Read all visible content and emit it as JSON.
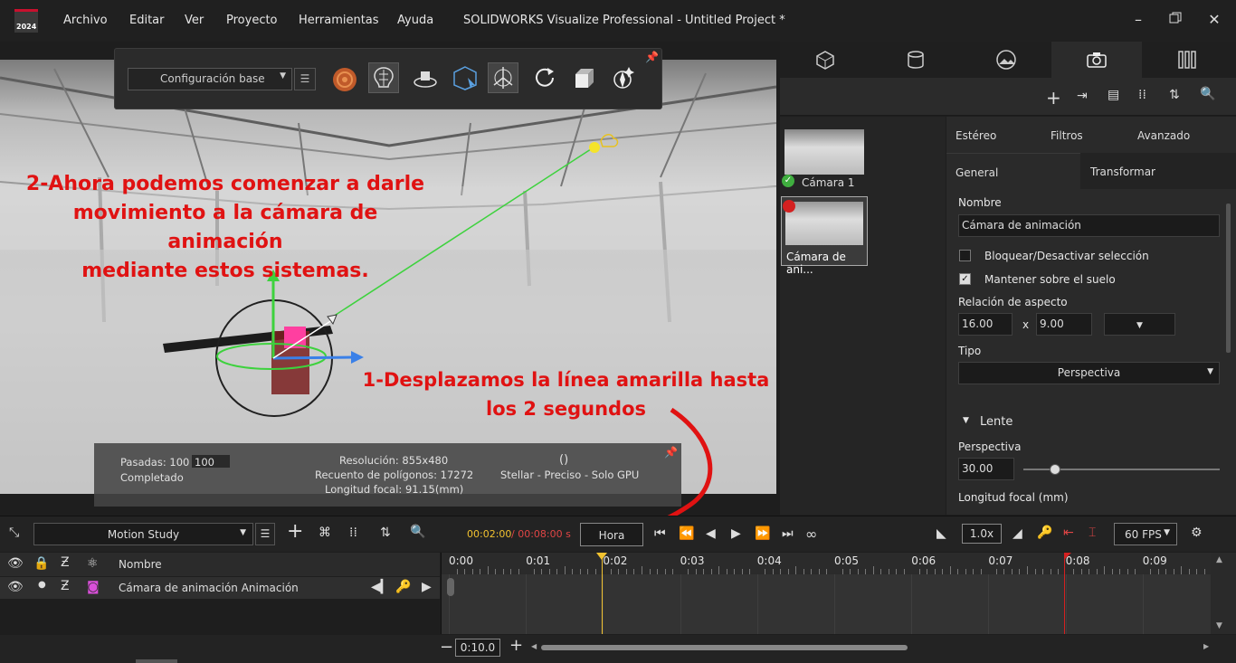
{
  "app": {
    "title": "SOLIDWORKS Visualize Professional - Untitled Project *",
    "logo_year": "2024"
  },
  "menu": [
    "Archivo",
    "Editar",
    "Ver",
    "Proyecto",
    "Herramientas",
    "Ayuda"
  ],
  "toolbar": {
    "config_select": "Configuración base"
  },
  "annotations": {
    "a2": [
      "2-Ahora podemos comenzar a darle",
      "movimiento a la cámara de animación",
      "mediante estos sistemas."
    ],
    "a1": [
      "1-Desplazamos la línea amarilla hasta",
      "los 2 segundos"
    ]
  },
  "stats": {
    "passes_label": "Pasadas: 100 /",
    "passes_value": "100",
    "completed": "Completado",
    "resolution": "Resolución: 855x480",
    "polygons": "Recuento de polígonos: 17272",
    "focal": "Longitud focal: 91.15(mm)",
    "mode": "Stellar - Preciso - Solo GPU"
  },
  "cameras": [
    {
      "label": "Cámara 1"
    },
    {
      "label": "Cámara de ani..."
    }
  ],
  "props": {
    "tabs_top": [
      "Estéreo",
      "Filtros",
      "Avanzado"
    ],
    "tabs_sub": [
      "General",
      "Transformar"
    ],
    "name_label": "Nombre",
    "name_value": "Cámara de animación",
    "lock_label": "Bloquear/Desactivar selección",
    "ground_label": "Mantener sobre el suelo",
    "aspect_label": "Relación de aspecto",
    "aspect_w": "16.00",
    "aspect_x": "x",
    "aspect_h": "9.00",
    "type_label": "Tipo",
    "type_value": "Perspectiva",
    "lens_label": "Lente",
    "persp_label": "Perspectiva",
    "persp_value": "30.00",
    "persp_slider": 0.06,
    "focal_label": "Longitud focal (mm)"
  },
  "bottom": {
    "study": "Motion Study",
    "time_current": "00:02:00",
    "time_total": "/ 00:08:00 s",
    "hora": "Hora",
    "speed": "1.0x",
    "fps": "60 FPS",
    "zoom": "0:10.0"
  },
  "timeline": {
    "header_name": "Nombre",
    "row_name": "Cámara de animación Animación",
    "ticks": [
      "0:00",
      "0:01",
      "0:02",
      "0:03",
      "0:04",
      "0:05",
      "0:06",
      "0:07",
      "0:08",
      "0:09"
    ]
  }
}
